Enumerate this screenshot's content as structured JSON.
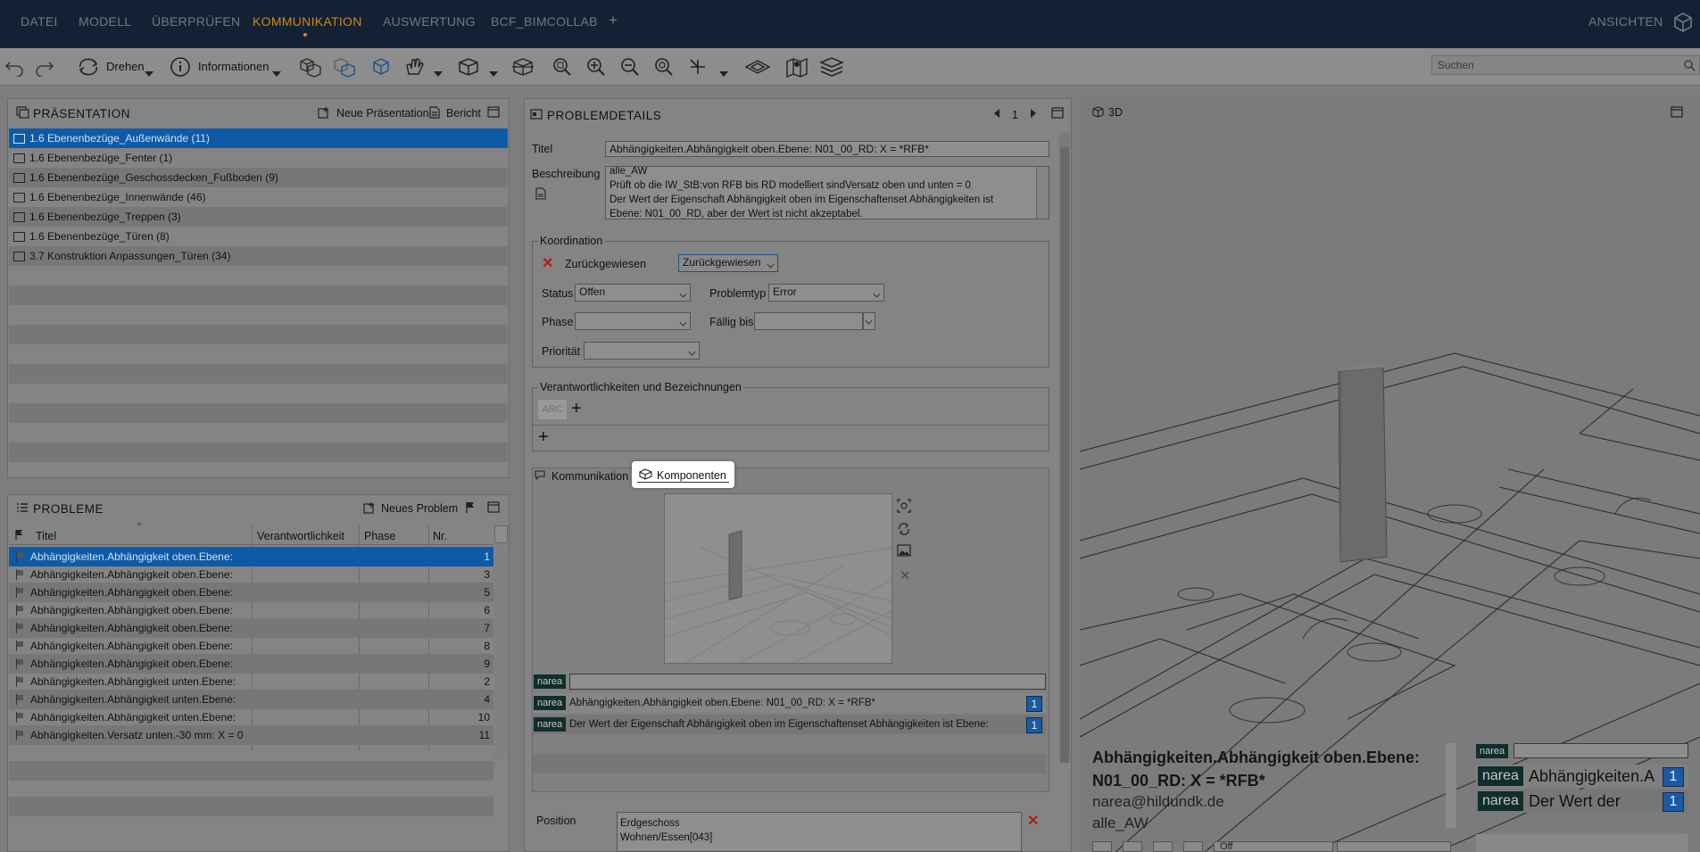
{
  "menubar": {
    "items": [
      "DATEI",
      "MODELL",
      "ÜBERPRÜFEN",
      "KOMMUNIKATION",
      "AUSWERTUNG",
      "BCF_BIMCOLLAB",
      "+"
    ],
    "active_index": 3,
    "right_label": "ANSICHTEN",
    "accent_color": "#c98a1f"
  },
  "toolbar": {
    "drehen_label": "Drehen",
    "informationen_label": "Informationen",
    "search_placeholder": "Suchen"
  },
  "presentation": {
    "title": "PRÄSENTATION",
    "new_label": "Neue Präsentation",
    "report_label": "Bericht",
    "items": [
      "1.6 Ebenenbezüge_Außenwände (11)",
      "1.6 Ebenenbezüge_Fenter (1)",
      "1.6 Ebenenbezüge_Geschossdecken_Fußboden (9)",
      "1.6 Ebenenbezüge_Innenwände (46)",
      "1.6 Ebenenbezüge_Treppen (3)",
      "1.6 Ebenenbezüge_Türen (8)",
      "3.7 Konstruktion Anpassungen_Türen (34)"
    ],
    "selected_index": 0
  },
  "problems": {
    "title": "PROBLEME",
    "new_label": "Neues Problem",
    "columns": [
      "Titel",
      "Verantwortlichkeit",
      "Phase",
      "Nr."
    ],
    "rows": [
      {
        "title": "Abhängigkeiten.Abhängigkeit oben.Ebene:",
        "nr": "1"
      },
      {
        "title": "Abhängigkeiten.Abhängigkeit oben.Ebene:",
        "nr": "3"
      },
      {
        "title": "Abhängigkeiten.Abhängigkeit oben.Ebene:",
        "nr": "5"
      },
      {
        "title": "Abhängigkeiten.Abhängigkeit oben.Ebene:",
        "nr": "6"
      },
      {
        "title": "Abhängigkeiten.Abhängigkeit oben.Ebene:",
        "nr": "7"
      },
      {
        "title": "Abhängigkeiten.Abhängigkeit oben.Ebene:",
        "nr": "8"
      },
      {
        "title": "Abhängigkeiten.Abhängigkeit oben.Ebene:",
        "nr": "9"
      },
      {
        "title": "Abhängigkeiten.Abhängigkeit unten.Ebene:",
        "nr": "2"
      },
      {
        "title": "Abhängigkeiten.Abhängigkeit unten.Ebene:",
        "nr": "4"
      },
      {
        "title": "Abhängigkeiten.Abhängigkeit unten.Ebene:",
        "nr": "10"
      },
      {
        "title": "Abhängigkeiten.Versatz unten.-30 mm: X = 0",
        "nr": "11"
      }
    ],
    "selected_index": 0
  },
  "details": {
    "title": "PROBLEMDETAILS",
    "page": "1",
    "title_label": "Titel",
    "title_value": "Abhängigkeiten.Abhängigkeit oben.Ebene: N01_00_RD: X = *RFB*",
    "description_label": "Beschreibung",
    "description_lines": [
      "alle_AW",
      "Prüft ob die IW_StB:von RFB bis RD modelliert sindVersatz oben und unten = 0",
      "Der Wert der Eigenschaft Abhängigkeit oben im Eigenschaftenset Abhängigkeiten ist",
      "Ebene: N01_00_RD, aber der Wert ist nicht akzeptabel."
    ],
    "coordination": {
      "group_label": "Koordination",
      "rejected_label": "Zurückgewiesen",
      "rejected_select": "Zurückgewiesen",
      "status_label": "Status",
      "status_value": "Offen",
      "problemtyp_label": "Problemtyp",
      "problemtyp_value": "Error",
      "phase_label": "Phase",
      "phase_value": "",
      "faellig_label": "Fällig bis",
      "faellig_value": "",
      "prioritaet_label": "Priorität",
      "prioritaet_value": ""
    },
    "responsibility": {
      "group_label": "Verantwortlichkeiten und Bezeichnungen",
      "tag": "ARC"
    },
    "tabs": [
      "Kommunikation",
      "Komponenten"
    ],
    "active_tab": 1,
    "comments": {
      "author": "narea",
      "input_value": "",
      "items": [
        {
          "author": "narea",
          "text": "Abhängigkeiten.Abhängigkeit oben.Ebene: N01_00_RD: X = *RFB*",
          "count": "1"
        },
        {
          "author": "narea",
          "text": "Der Wert der Eigenschaft Abhängigkeit oben im Eigenschaftenset Abhängigkeiten ist Ebene:",
          "count": "1"
        }
      ]
    },
    "position_label": "Position",
    "position_lines": [
      "Erdgeschoss",
      "Wohnen/Essen[043]"
    ]
  },
  "view3d": {
    "title": "3D",
    "overlay_title_line1": "Abhängigkeiten.Abhängigkeit oben.Ebene:",
    "overlay_title_line2": "N01_00_RD: X = *RFB*",
    "overlay_email": "narea@hildundk.de",
    "overlay_subtitle": "alle_AW",
    "overlay_author": "narea",
    "overlay_comment1": "Abhängigkeiten.A",
    "overlay_comment2": "Der Wert der",
    "overlay_count1": "1",
    "overlay_count2": "1",
    "overlay_select": "Off"
  }
}
